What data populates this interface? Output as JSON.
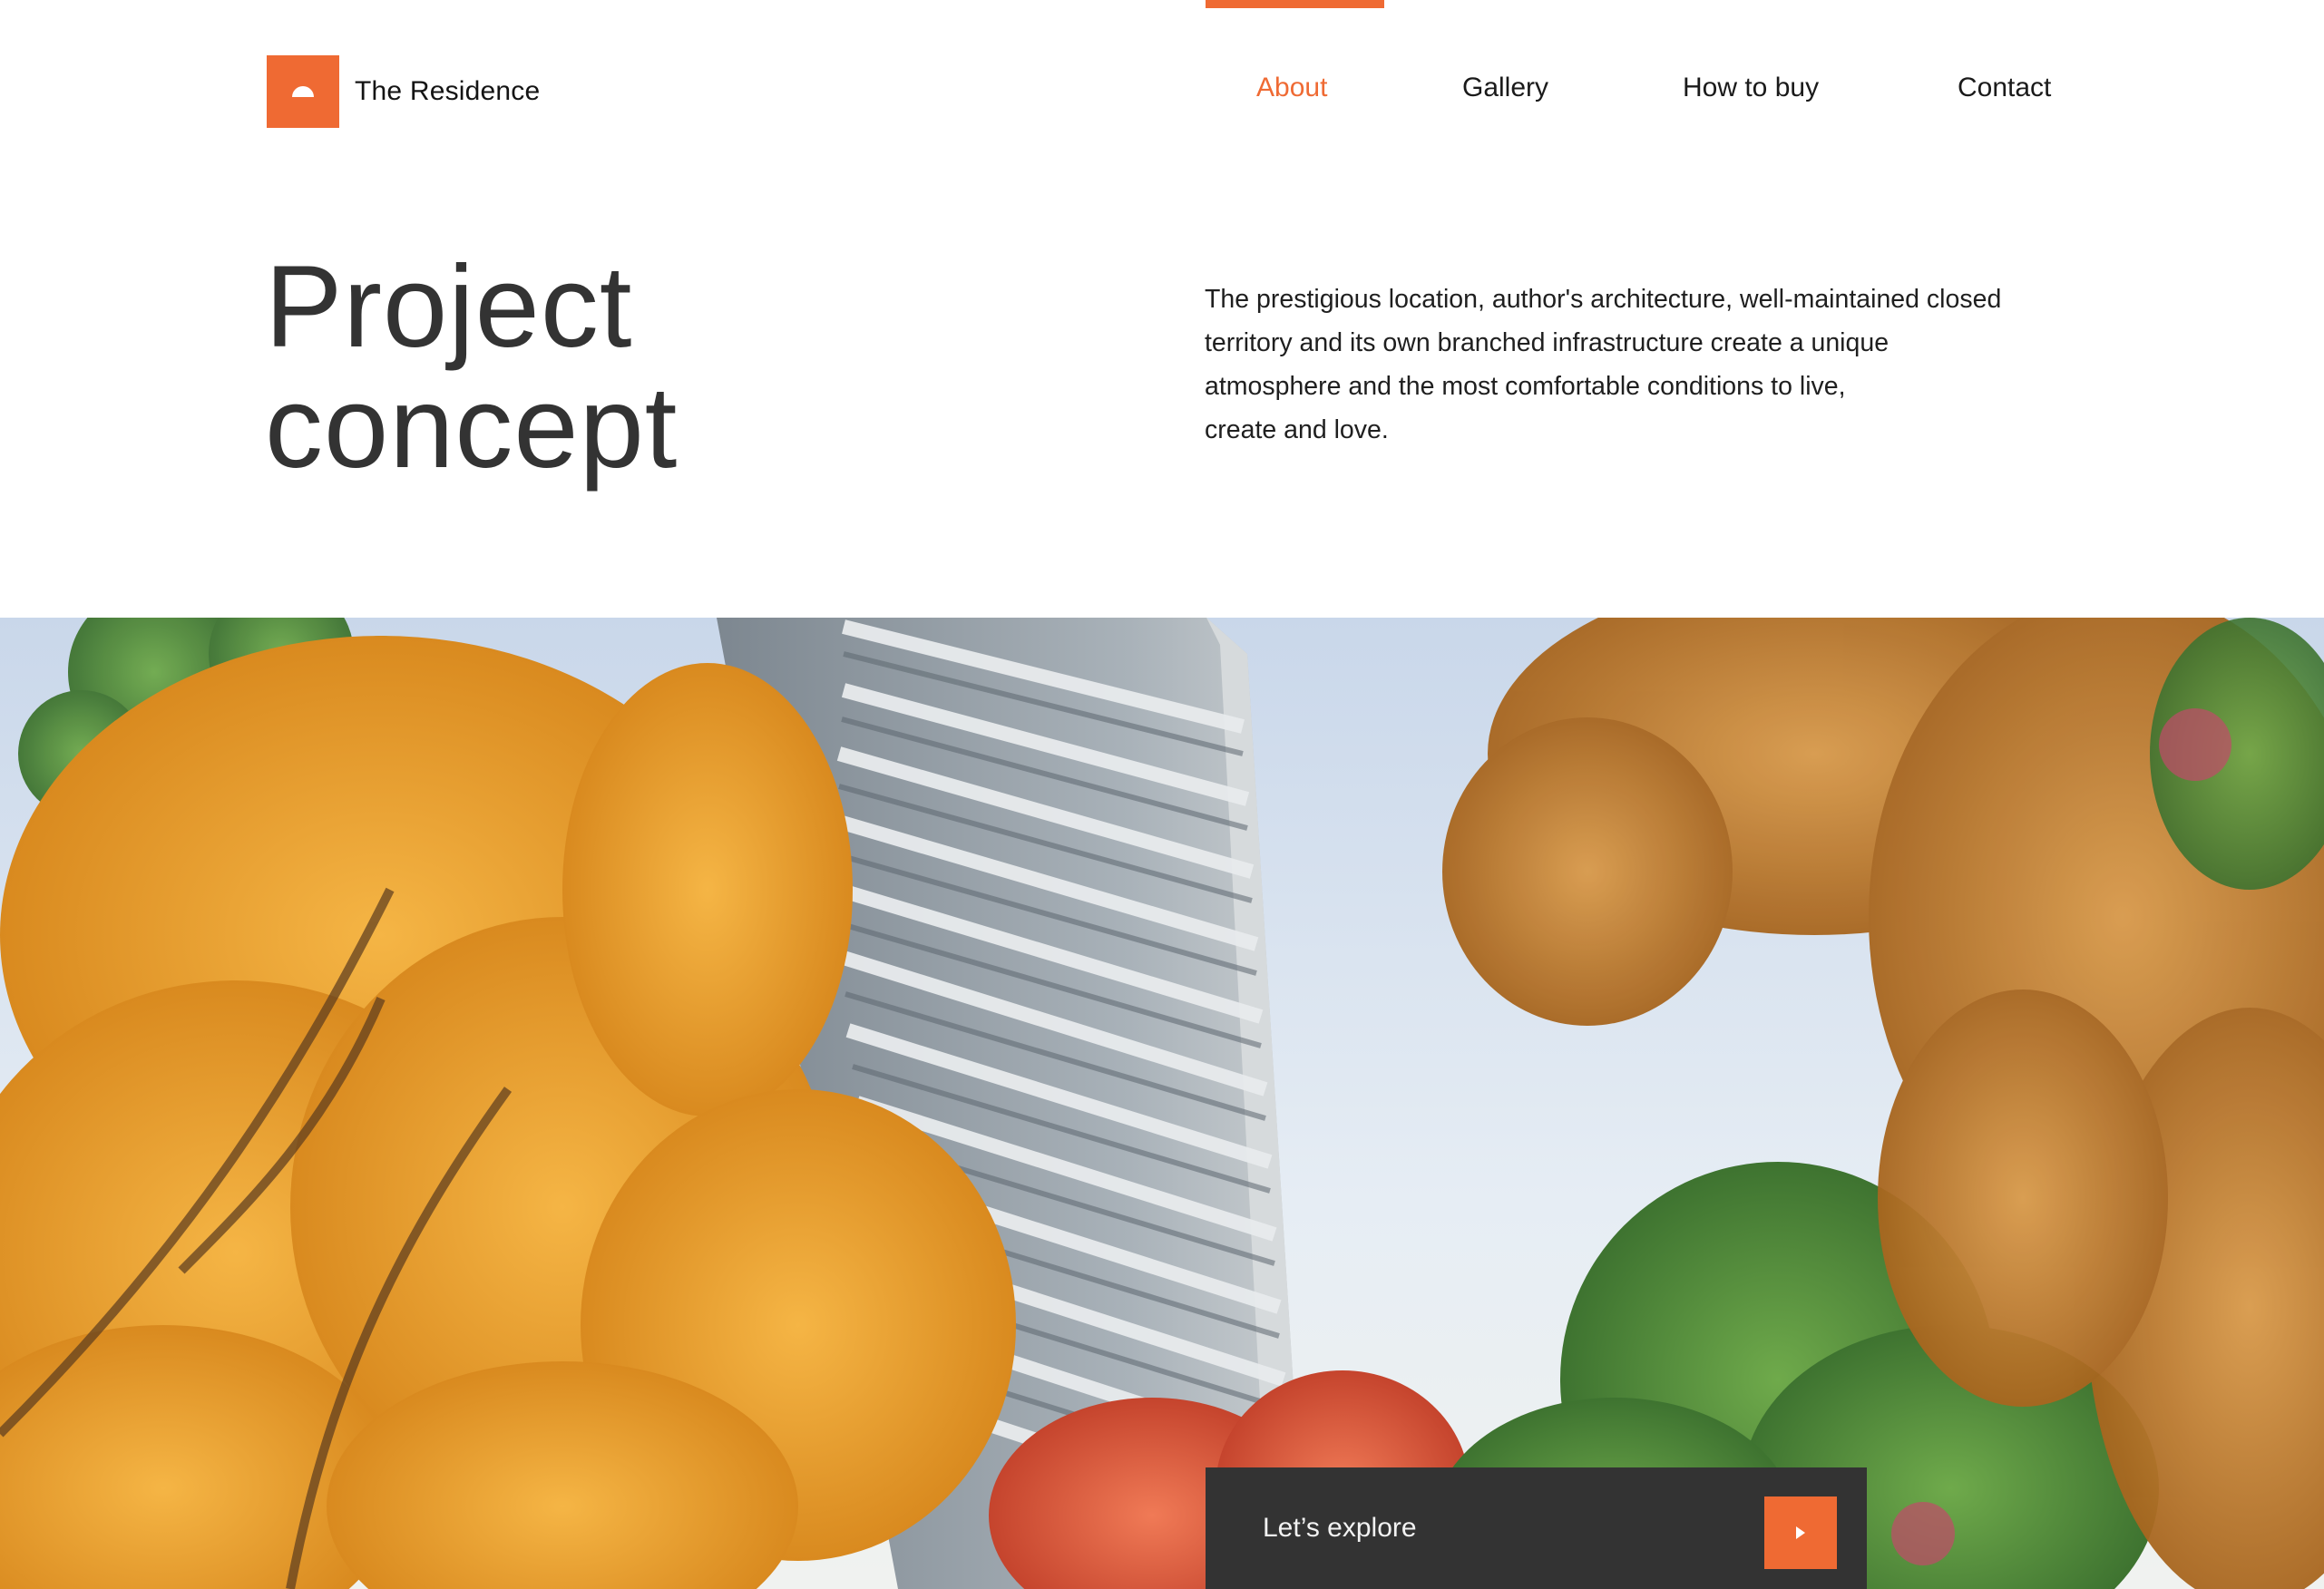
{
  "brand": {
    "name": "The Residence",
    "accent": "#ef6a33",
    "logo_icon": "half-circle-icon"
  },
  "nav": {
    "active": "About",
    "items": [
      {
        "label": "About"
      },
      {
        "label": "Gallery"
      },
      {
        "label": "How to buy"
      },
      {
        "label": "Contact"
      }
    ]
  },
  "hero": {
    "title_line1": "Project",
    "title_line2": "concept",
    "intro_lines": [
      "The prestigious location, author's architecture, well-maintained closed",
      "territory and its own branched infrastructure create a unique",
      "atmosphere and the most comfortable conditions to live,",
      "create and love."
    ]
  },
  "photo": {
    "subject": "residential-tower-among-autumn-trees"
  },
  "cta": {
    "label": "Let’s explore",
    "icon": "play-arrow-icon"
  }
}
